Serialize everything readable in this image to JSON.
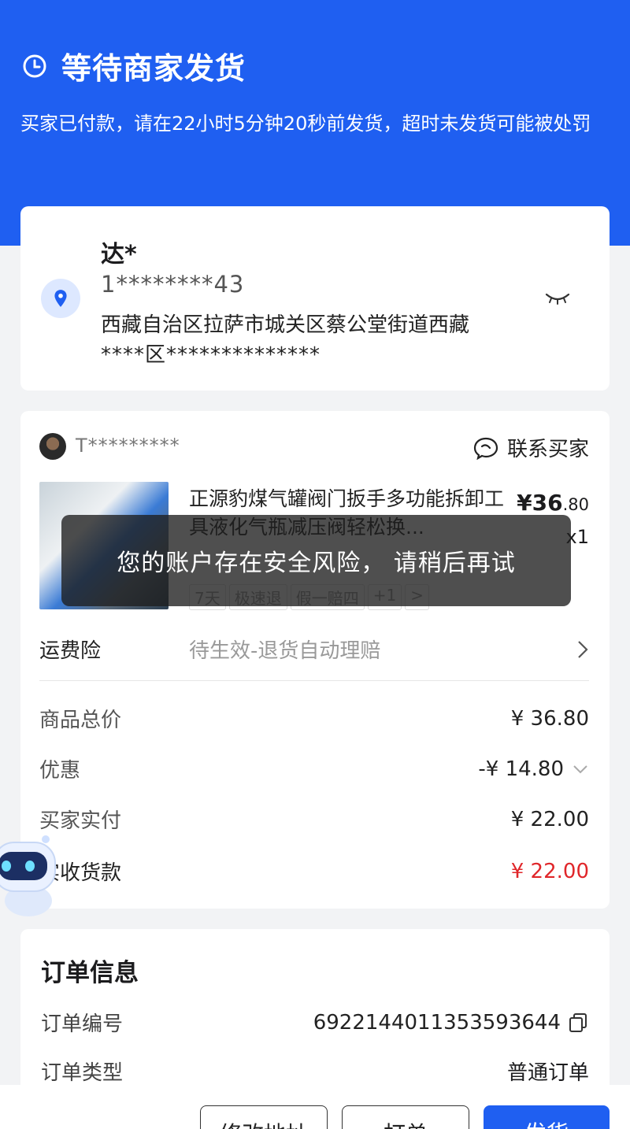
{
  "header": {
    "title": "等待商家发货",
    "description": "买家已付款，请在22小时5分钟20秒前发货，超时未发货可能被处罚"
  },
  "address": {
    "name": "达*",
    "phone": "1********43",
    "line1": "西藏自治区拉萨市城关区蔡公堂街道西藏",
    "line2": "****区**************"
  },
  "seller": {
    "name": "T*********",
    "contact_label": "联系买家"
  },
  "product": {
    "title": "正源豹煤气罐阀门扳手多功能拆卸工具液化气瓶减压阀轻松换...",
    "price_int": "¥36",
    "price_dec": ".80",
    "qty": "x1",
    "tags": [
      "7天",
      "极速退",
      "假一赔四",
      "+1"
    ]
  },
  "toast": "您的账户存在安全风险， 请稍后再试",
  "shipping_insurance": {
    "label": "运费险",
    "status": "待生效-退货自动理赔"
  },
  "summary": {
    "total_label": "商品总价",
    "total_value": "¥ 36.80",
    "discount_label": "优惠",
    "discount_value": "-¥ 14.80",
    "paid_label": "买家实付",
    "paid_value": "¥ 22.00",
    "receive_label": "实收货款",
    "receive_value": "¥ 22.00"
  },
  "order_info": {
    "title": "订单信息",
    "number_label": "订单编号",
    "number_value": "6922144011353593644",
    "type_label": "订单类型",
    "type_value": "普通订单"
  },
  "actions": {
    "modify_address": "修改地址",
    "print_order": "打单",
    "ship": "发货"
  },
  "colors": {
    "primary": "#1f5ff1",
    "danger": "#e0262a"
  }
}
